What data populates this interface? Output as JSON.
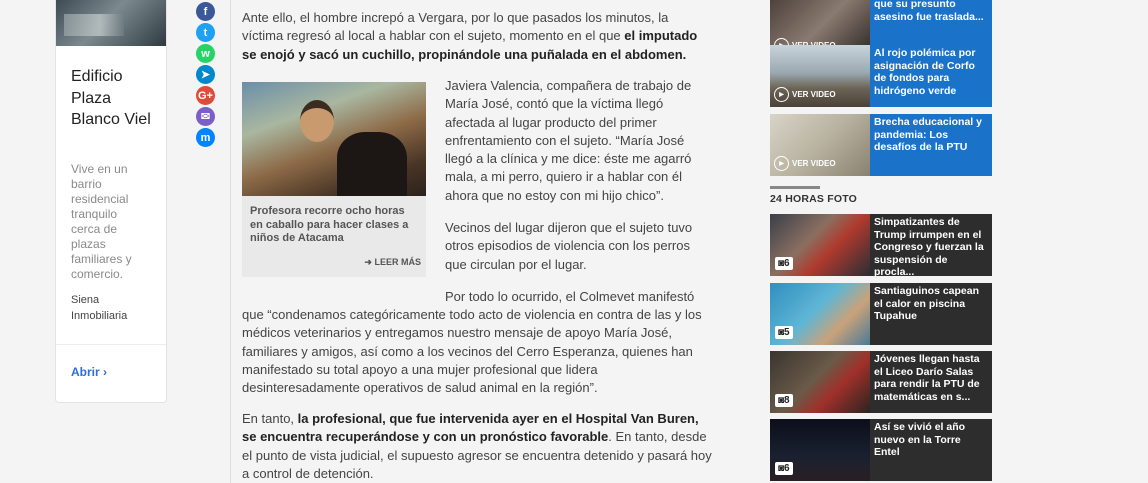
{
  "ad": {
    "title": "Edificio Plaza Blanco Viel",
    "description": "Vive en un barrio residencial tranquilo cerca de plazas familiares y comercio.",
    "brand": "Siena Inmobiliaria",
    "open_label": "Abrir"
  },
  "share_icons": [
    {
      "name": "facebook-icon",
      "glyph": "f",
      "color": "#3b5998"
    },
    {
      "name": "twitter-icon",
      "glyph": "t",
      "color": "#1da1f2"
    },
    {
      "name": "whatsapp-icon",
      "glyph": "w",
      "color": "#25d366"
    },
    {
      "name": "telegram-icon",
      "glyph": "➤",
      "color": "#0088cc"
    },
    {
      "name": "google-plus-icon",
      "glyph": "G+",
      "color": "#dd4b39"
    },
    {
      "name": "email-icon",
      "glyph": "✉",
      "color": "#7b5ec6"
    },
    {
      "name": "messenger-icon",
      "glyph": "m",
      "color": "#0084ff"
    }
  ],
  "article": {
    "p1_a": "Ante ello, el hombre increpó a Vergara, por lo que pasados los minutos, la víctima regresó al local a hablar con el sujeto, momento en el que ",
    "p1_b": "el imputado se enojó y sacó un cuchillo, propinándole una puñalada en el abdomen.",
    "p2": "Javiera Valencia, compañera de trabajo de María José, contó que la víctima llegó afectada al lugar producto del primer enfrentamiento con el sujeto. “María José llegó a la clínica y me dice: éste me agarró mala, a mi perro, quiero ir a hablar con él ahora que no estoy con mi hijo chico”.",
    "p3": "Vecinos del lugar dijeron que el sujeto tuvo otros episodios de violencia con los perros que circulan por el lugar.",
    "p4_first": "Por todo lo ocurrido, el Colmevet manifestó",
    "p4_rest": "que “condenamos categóricamente todo acto de violencia en contra de las y los médicos veterinarios y entregamos nuestro mensaje de apoyo María José, familiares y amigos, así como a los vecinos del Cerro Esperanza, quienes han manifestado su total apoyo a una mujer profesional que lidera desinteresadamente operativos de salud animal en la región”.",
    "p5_a": "En tanto, ",
    "p5_b": "la profesional, que fue intervenida ayer en el Hospital Van Buren, se encuentra recuperándose y con un pronóstico favorable",
    "p5_c": ". En tanto, desde el punto de vista judicial, el supuesto agresor se encuentra detenido y pasará hoy a control de detención."
  },
  "related": {
    "caption": "Profesora recorre ocho horas en caballo para hacer clases a niños de Atacama",
    "more_label": "LEER MÁS"
  },
  "videos": {
    "badge_label": "VER VIDEO",
    "items": [
      {
        "title": "que su presunto asesino fue traslada..."
      },
      {
        "title": "Al rojo polémica por asignación de Corfo de fondos para hidrógeno verde"
      },
      {
        "title": "Brecha educacional y pandemia: Los desafíos de la PTU"
      }
    ]
  },
  "fotos": {
    "section_title": "24 HORAS FOTO",
    "items": [
      {
        "title": "Simpatizantes de Trump irrumpen en el Congreso y fuerzan la suspensión de procla...",
        "count": "6"
      },
      {
        "title": "Santiaguinos capean el calor en piscina Tupahue",
        "count": "5"
      },
      {
        "title": "Jóvenes llegan hasta el Liceo Darío Salas para rendir la PTU de matemáticas en s...",
        "count": "8"
      },
      {
        "title": "Así se vivió el año nuevo en la Torre Entel",
        "count": "6"
      }
    ]
  }
}
